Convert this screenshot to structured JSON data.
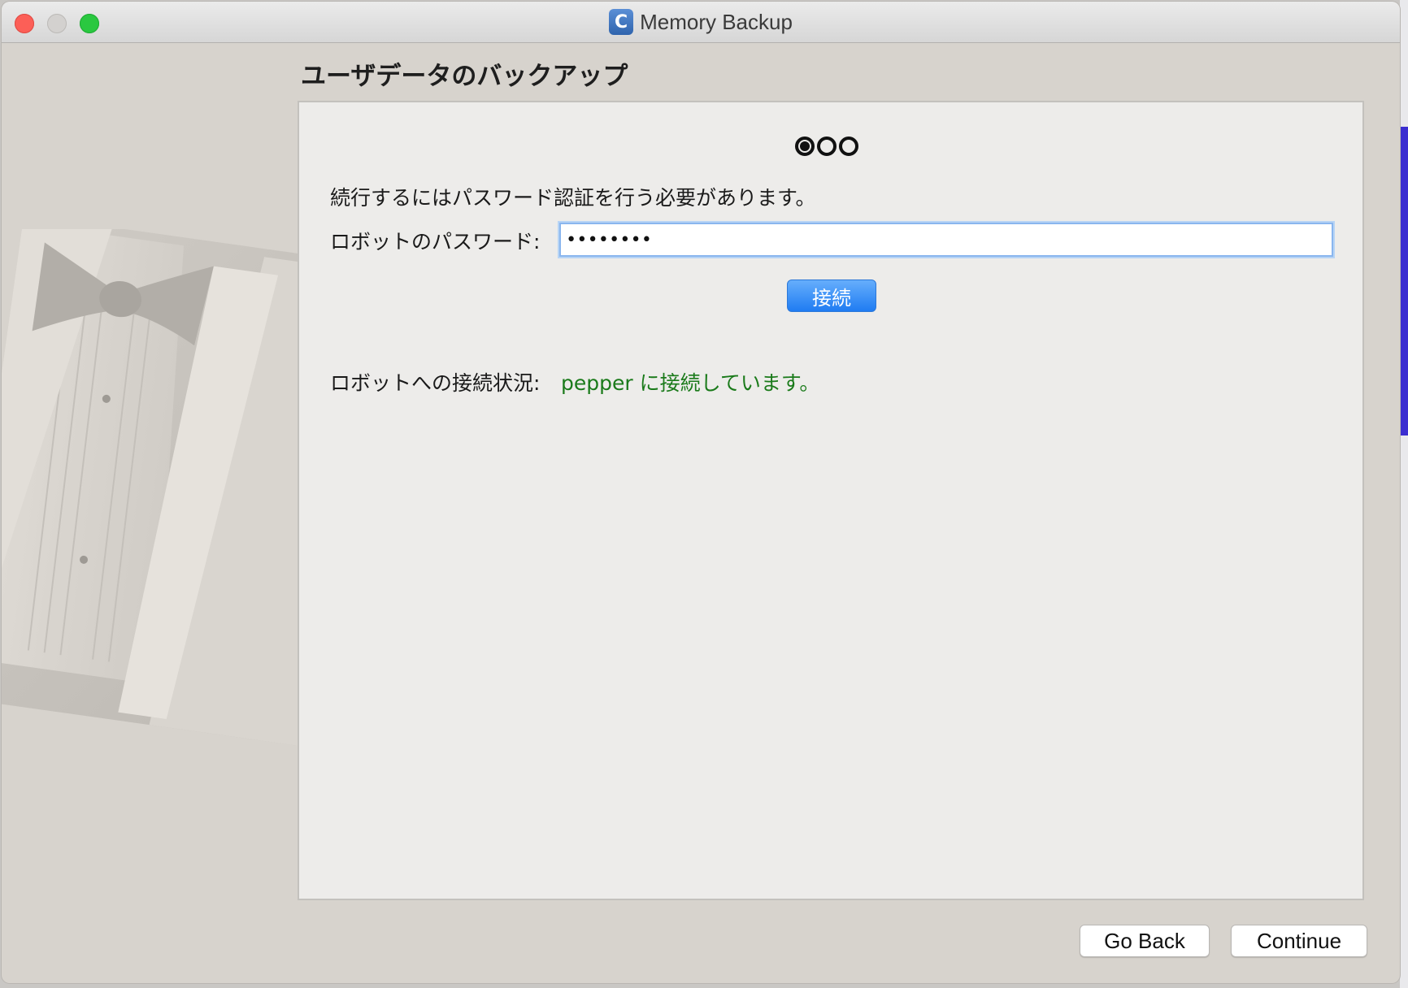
{
  "window": {
    "title": "Memory Backup",
    "app_icon_letter": "C"
  },
  "heading": "ユーザデータのバックアップ",
  "steps": {
    "total": 3,
    "current": 1
  },
  "form": {
    "instruction": "続行するにはパスワード認証を行う必要があります。",
    "password_label": "ロボットのパスワード:",
    "password_value": "••••••••",
    "connect_label": "接続"
  },
  "status": {
    "label": "ロボットへの接続状況:",
    "value": "pepper に接続しています。",
    "color": "#1a7a1a"
  },
  "footer": {
    "back_label": "Go Back",
    "continue_label": "Continue"
  },
  "illustration": "tuxedo-icon"
}
